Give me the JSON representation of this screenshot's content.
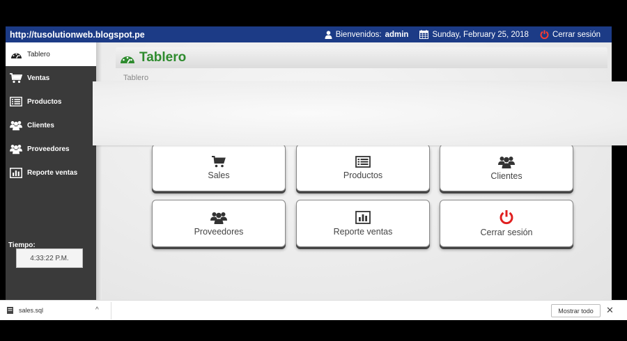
{
  "topbar": {
    "url": "http://tusolutionweb.blogspot.pe",
    "welcome_prefix": "Bienvenidos:",
    "welcome_user": "admin",
    "date": "Sunday, February 25, 2018",
    "logout": "Cerrar sesión"
  },
  "sidebar": {
    "items": [
      {
        "label": "Tablero",
        "icon": "dashboard-icon"
      },
      {
        "label": "Ventas",
        "icon": "cart-icon"
      },
      {
        "label": "Productos",
        "icon": "list-icon"
      },
      {
        "label": "Clientes",
        "icon": "users-icon"
      },
      {
        "label": "Proveedores",
        "icon": "users-icon"
      },
      {
        "label": "Reporte ventas",
        "icon": "bar-chart-icon"
      }
    ],
    "time_label": "Tiempo:",
    "time_value": "4:33:22 P.M."
  },
  "main": {
    "title": "Tablero",
    "breadcrumb": "Tablero",
    "tiles": [
      {
        "label": "Sales",
        "icon": "cart-icon"
      },
      {
        "label": "Productos",
        "icon": "list-icon"
      },
      {
        "label": "Clientes",
        "icon": "users-icon"
      },
      {
        "label": "Proveedores",
        "icon": "users-icon"
      },
      {
        "label": "Reporte ventas",
        "icon": "bar-chart-icon"
      },
      {
        "label": "Cerrar sesión",
        "icon": "power-icon"
      }
    ]
  },
  "downloads": {
    "file": "sales.sql",
    "show_all": "Mostrar todo",
    "close": "✕",
    "chevron": "^"
  },
  "colors": {
    "topbar": "#1c3b86",
    "sidebar": "#3a3a3a",
    "title_green": "#2e8b2e",
    "power_red": "#e02020"
  }
}
